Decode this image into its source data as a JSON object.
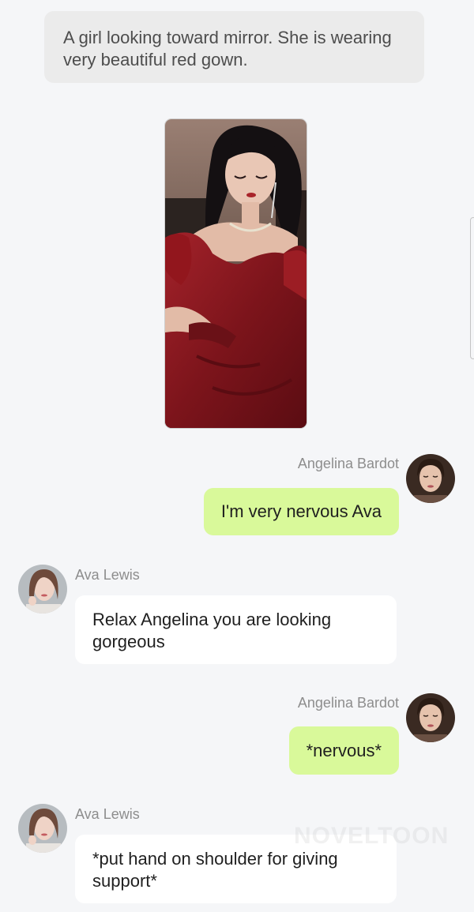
{
  "narration": {
    "text": "A girl looking toward mirror. She is wearing very beautiful red gown."
  },
  "messages": [
    {
      "sender": "Angelina Bardot",
      "side": "right",
      "text": "I'm very nervous Ava"
    },
    {
      "sender": "Ava Lewis",
      "side": "left",
      "text": "Relax Angelina you are looking gorgeous"
    },
    {
      "sender": "Angelina Bardot",
      "side": "right",
      "text": "*nervous*"
    },
    {
      "sender": "Ava Lewis",
      "side": "left",
      "text": "*put hand on shoulder for giving support*"
    }
  ],
  "watermark": {
    "text": "NOVELTOON"
  },
  "colors": {
    "background": "#f5f6f8",
    "narration_bubble": "#ebebeb",
    "outgoing_bubble": "#d9f99a",
    "incoming_bubble": "#ffffff",
    "sender_name": "#8d8d8d",
    "gown_red": "#8b1a1f"
  }
}
